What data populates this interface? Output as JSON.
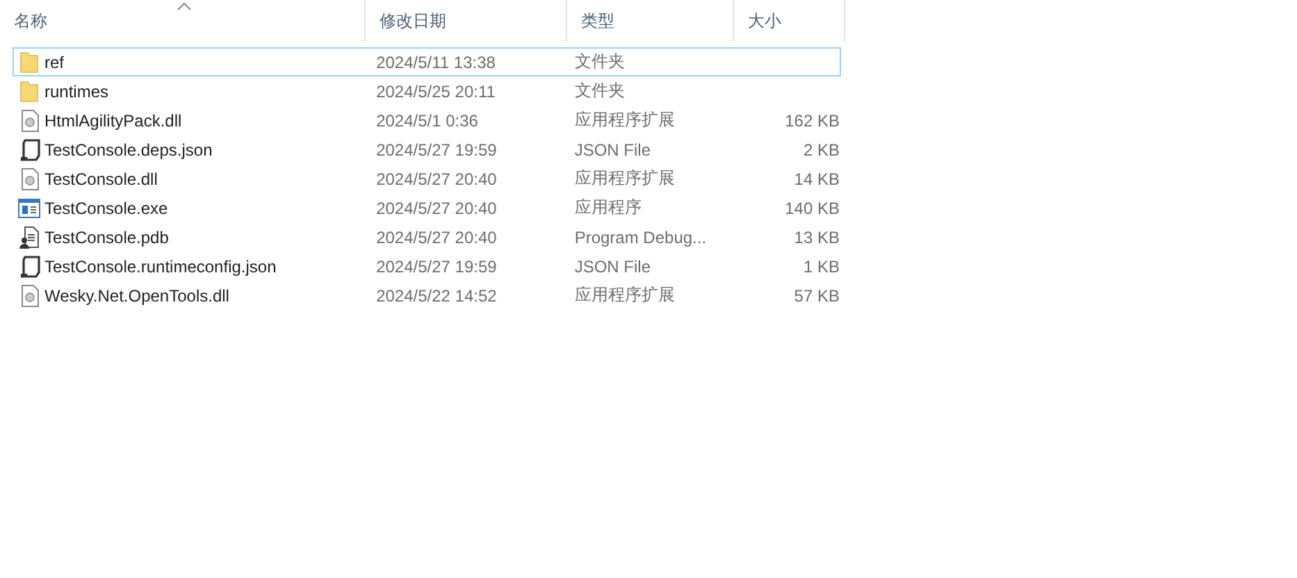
{
  "columns": [
    {
      "label": "名称",
      "sorted": true
    },
    {
      "label": "修改日期",
      "sorted": false
    },
    {
      "label": "类型",
      "sorted": false
    },
    {
      "label": "大小",
      "sorted": false
    }
  ],
  "rows": [
    {
      "kind": "folder",
      "name": "ref",
      "date": "2024/5/11 13:38",
      "type": "文件夹",
      "focused": true
    },
    {
      "kind": "folder",
      "name": "runtimes",
      "date": "2024/5/25 20:11",
      "type": "文件夹",
      "focused": false
    },
    {
      "kind": "dll",
      "name": "HtmlAgilityPack.dll",
      "date": "2024/5/1 0:36",
      "type": "应用程序扩展",
      "size": "162 KB",
      "focused": false
    },
    {
      "kind": "json",
      "name": "TestConsole.deps.json",
      "date": "2024/5/27 19:59",
      "type": "JSON File",
      "size": "2 KB",
      "focused": false
    },
    {
      "kind": "dll",
      "name": "TestConsole.dll",
      "date": "2024/5/27 20:40",
      "type": "应用程序扩展",
      "size": "14 KB",
      "focused": false
    },
    {
      "kind": "exe",
      "name": "TestConsole.exe",
      "date": "2024/5/27 20:40",
      "type": "应用程序",
      "size": "140 KB",
      "focused": false
    },
    {
      "kind": "pdb",
      "name": "TestConsole.pdb",
      "date": "2024/5/27 20:40",
      "type": "Program Debug...",
      "size": "13 KB",
      "focused": false
    },
    {
      "kind": "json",
      "name": "TestConsole.runtimeconfig.json",
      "date": "2024/5/27 19:59",
      "type": "JSON File",
      "size": "1 KB",
      "focused": false
    },
    {
      "kind": "dll",
      "name": "Wesky.Net.OpenTools.dll",
      "date": "2024/5/22 14:52",
      "type": "应用程序扩展",
      "size": "57 KB",
      "focused": false
    }
  ]
}
